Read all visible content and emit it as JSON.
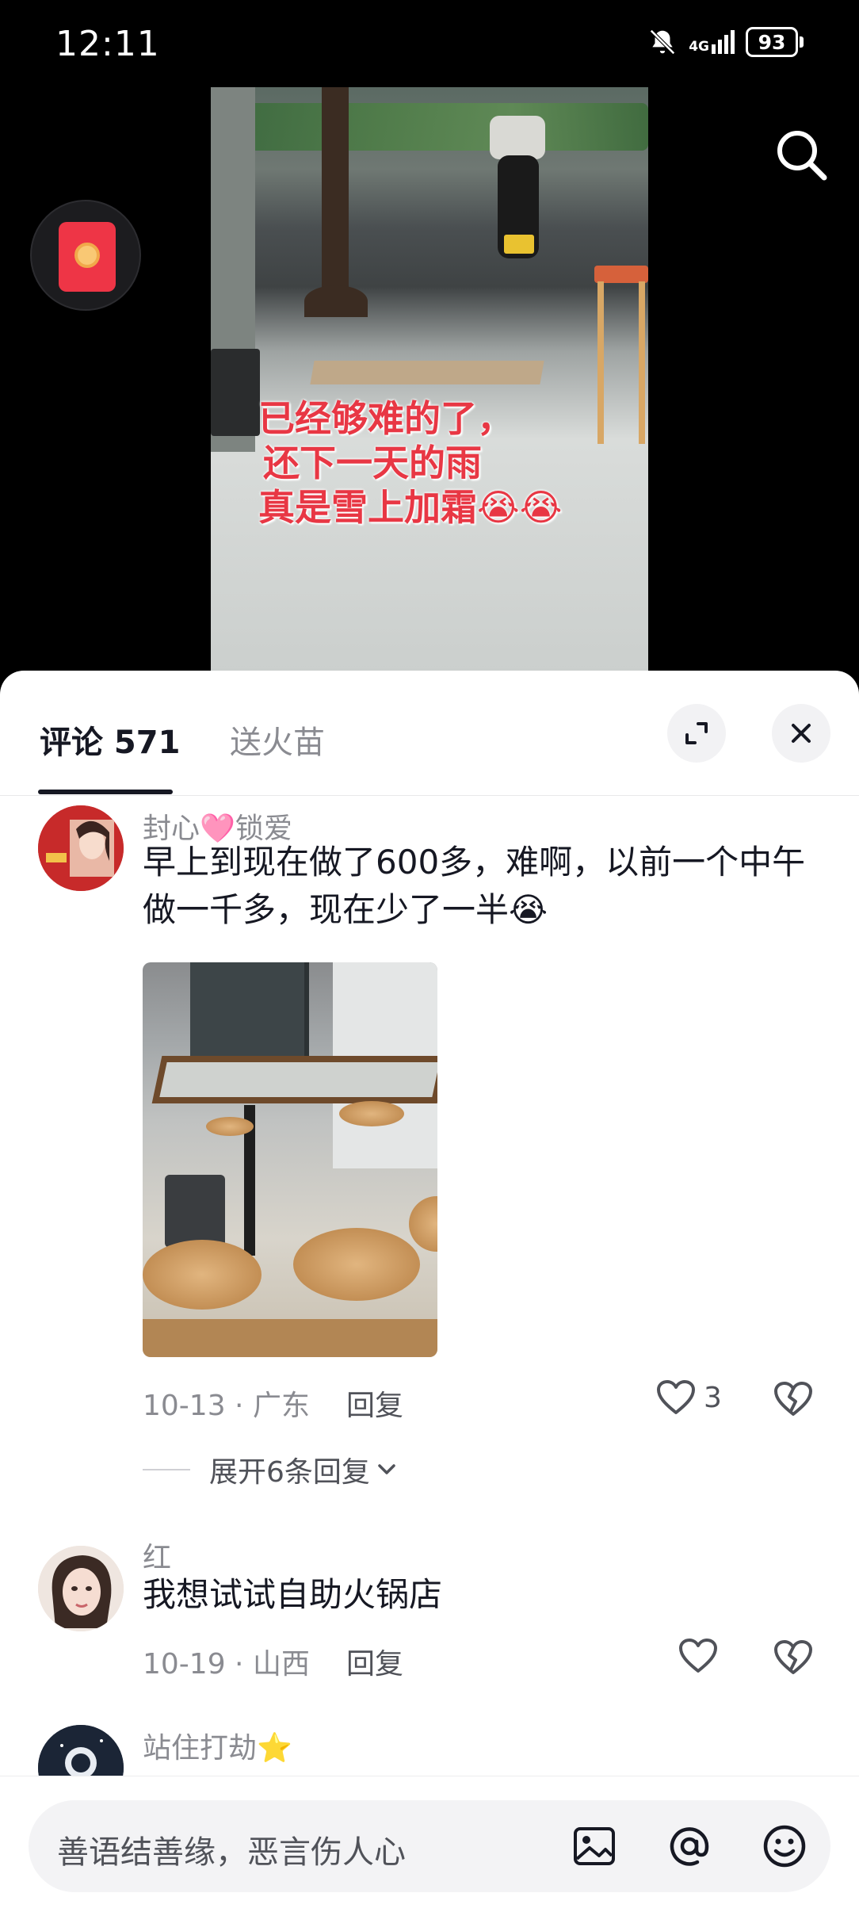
{
  "status_bar": {
    "time": "12:11",
    "network": "4G",
    "battery": "93"
  },
  "video": {
    "caption_lines": [
      "已经够难的了，",
      "还下一天的雨",
      "真是雪上加霜😭😭"
    ]
  },
  "comments_panel": {
    "tabs": [
      {
        "label": "评论 571",
        "active": true
      },
      {
        "label": "送火苗",
        "active": false
      }
    ],
    "comments": [
      {
        "username": "封心🩷锁爱",
        "text": "早上到现在做了600多，难啊，以前一个中午做一千多，现在少了一半😭",
        "has_image": true,
        "date_location": "10-13 · 广东",
        "reply_label": "回复",
        "likes": "3",
        "expand_label": "展开6条回复"
      },
      {
        "username": "红",
        "text": "我想试试自助火锅店",
        "has_image": false,
        "date_location": "10-19 · 山西",
        "reply_label": "回复",
        "likes": ""
      },
      {
        "username": "站住打劫⭐",
        "text": ""
      }
    ]
  },
  "input_bar": {
    "placeholder": "善语结善缘，恶言伤人心"
  },
  "colors": {
    "accent_red": "#ee3546",
    "caption_red": "#e83744",
    "text_primary": "#161823",
    "text_secondary": "#8a8b91"
  },
  "icons": [
    "search-icon",
    "red-packet-icon",
    "expand-icon",
    "close-icon",
    "heart-icon",
    "broken-heart-icon",
    "chevron-down-icon",
    "image-icon",
    "at-icon",
    "emoji-icon",
    "mute-bell-icon",
    "signal-icon",
    "battery-icon"
  ]
}
